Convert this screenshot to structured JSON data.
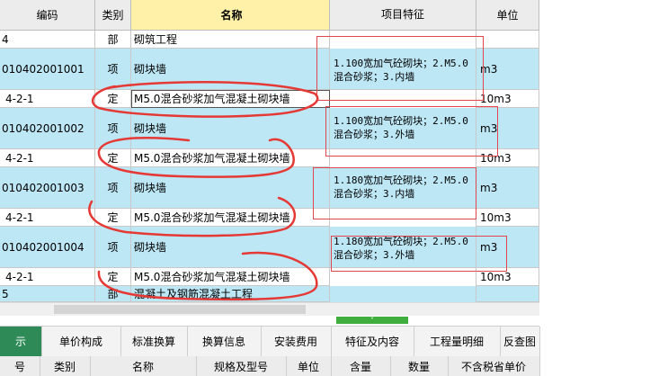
{
  "header": {
    "code": "编码",
    "type": "类别",
    "name": "名称",
    "feature": "项目特征",
    "unit": "单位"
  },
  "rows": [
    {
      "code": "4",
      "type": "部",
      "name": "砌筑工程",
      "feature": "",
      "unit": "",
      "style": "white"
    },
    {
      "code": "010402001001",
      "type": "项",
      "name": "砌块墙",
      "feature": "1.100宽加气砼砌块；2.M5.0\n混合砂浆；3.内墙",
      "unit": "m3",
      "style": "blue"
    },
    {
      "code": "4-2-1",
      "type": "定",
      "name": "M5.0混合砂浆加气混凝土砌块墙",
      "feature": "",
      "unit": "10m3",
      "style": "white"
    },
    {
      "code": "010402001002",
      "type": "项",
      "name": "砌块墙",
      "feature": "1.100宽加气砼砌块；2.M5.0\n混合砂浆；3.外墙",
      "unit": "m3",
      "style": "blue"
    },
    {
      "code": "4-2-1",
      "type": "定",
      "name": "M5.0混合砂浆加气混凝土砌块墙",
      "feature": "",
      "unit": "10m3",
      "style": "white"
    },
    {
      "code": "010402001003",
      "type": "项",
      "name": "砌块墙",
      "feature": "1.180宽加气砼砌块；2.M5.0\n混合砂浆；3.内墙",
      "unit": "m3",
      "style": "blue"
    },
    {
      "code": "4-2-1",
      "type": "定",
      "name": "M5.0混合砂浆加气混凝土砌块墙",
      "feature": "",
      "unit": "10m3",
      "style": "white"
    },
    {
      "code": "010402001004",
      "type": "项",
      "name": "砌块墙",
      "feature": "1.180宽加气砼砌块；2.M5.0\n混合砂浆；3.外墙",
      "unit": "m3",
      "style": "blue"
    },
    {
      "code": "4-2-1",
      "type": "定",
      "name": "M5.0混合砂浆加气混凝土砌块墙",
      "feature": "",
      "unit": "10m3",
      "style": "white"
    },
    {
      "code": "5",
      "type": "部",
      "name": "混凝土及钢筋混凝土工程",
      "feature": "",
      "unit": "",
      "style": "blue"
    }
  ],
  "tabs": [
    "示",
    "单价构成",
    "标准换算",
    "换算信息",
    "安装费用",
    "特征及内容",
    "工程量明细",
    "反查图"
  ],
  "bottom_header": [
    "号",
    "类别",
    "名称",
    "规格及型号",
    "单位",
    "含量",
    "数量",
    "不含税省单价"
  ],
  "colors": {
    "row_blue": "#bde7f5",
    "header_name": "#fff2a8",
    "active_tab": "#2e8b57",
    "annotation": "#e0474c"
  },
  "splitter_icon": "double-chevron-down-icon"
}
